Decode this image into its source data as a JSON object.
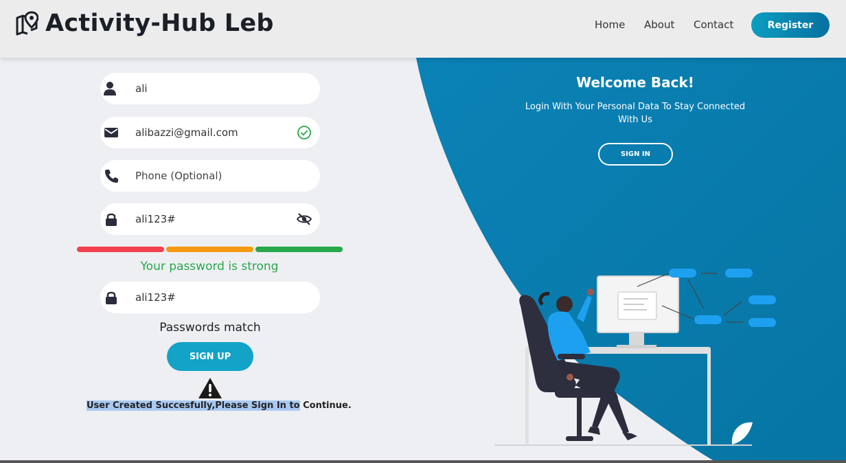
{
  "header": {
    "brand": "Activity-Hub Leb",
    "nav": [
      "Home",
      "About",
      "Contact"
    ],
    "register_label": "Register"
  },
  "form": {
    "title_fragment": "g",
    "fields": [
      {
        "icon": "user-icon",
        "value": "ali"
      },
      {
        "icon": "envelope-icon",
        "value": "alibazzi@gmail.com",
        "trail_icon": "check-circle-icon"
      },
      {
        "icon": "phone-icon",
        "placeholder": "Phone (Optional)"
      },
      {
        "icon": "lock-icon",
        "value": "ali123#",
        "trail_icon": "eye-slash-icon"
      },
      {
        "icon": "lock-icon",
        "value": "ali123#"
      }
    ],
    "strength_colors": [
      "#f2404f",
      "#f59a13",
      "#27a84a"
    ],
    "strength_text": "Your password is strong",
    "match_text": "Passwords match",
    "signup_label": "SIGN UP",
    "warning_icon": "warning-icon",
    "success_highlighted": "User Created Succesfully,Please Sign In to",
    "success_rest": " Continue."
  },
  "panel": {
    "title": "Welcome Back!",
    "subtitle": "Login With Your Personal Data To Stay Connected With Us",
    "signin_label": "SIGN IN"
  },
  "colors": {
    "panel_blue": "#0684b4",
    "accent": "#12a3c7",
    "success": "#27a84a"
  }
}
